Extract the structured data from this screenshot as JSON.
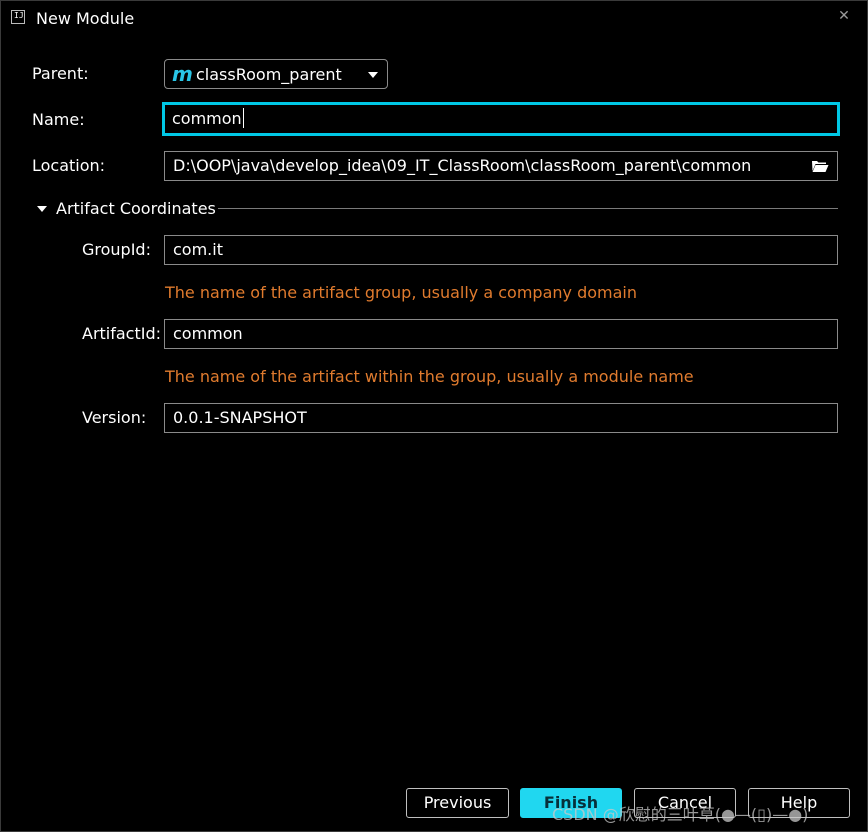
{
  "window": {
    "title": "New Module",
    "app_icon_text": "IJ"
  },
  "form": {
    "parent": {
      "label": "Parent:",
      "value": "classRoom_parent"
    },
    "name": {
      "label": "Name:",
      "value": "common"
    },
    "location": {
      "label": "Location:",
      "value": "D:\\OOP\\java\\develop_idea\\09_IT_ClassRoom\\classRoom_parent\\common"
    }
  },
  "artifact": {
    "section_label": "Artifact Coordinates",
    "group_id": {
      "label": "GroupId:",
      "value": "com.it",
      "hint": "The name of the artifact group, usually a company domain"
    },
    "artifact_id": {
      "label": "ArtifactId:",
      "value": "common",
      "hint": "The name of the artifact within the group, usually a module name"
    },
    "version": {
      "label": "Version:",
      "value": "0.0.1-SNAPSHOT"
    }
  },
  "buttons": {
    "previous": "Previous",
    "finish": "Finish",
    "cancel": "Cancel",
    "help": "Help"
  },
  "watermark": "CSDN @欣慰的三叶草(●—(▯)—●)",
  "colors": {
    "accent": "#20d7f0",
    "focus_border": "#00c8e6",
    "hint": "#e07b2e",
    "background": "#000000"
  }
}
